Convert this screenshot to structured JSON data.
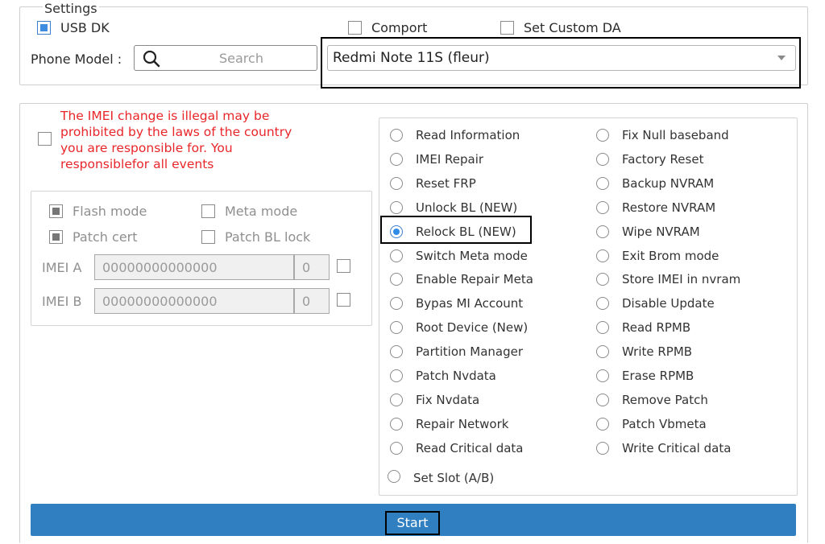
{
  "settings": {
    "title": "Settings",
    "usb_dk": {
      "label": "USB DK",
      "checked": true
    },
    "comport": {
      "label": "Comport",
      "checked": false
    },
    "set_custom_da": {
      "label": "Set Custom DA",
      "checked": false
    },
    "phone_model_label": "Phone Model :",
    "search_placeholder": "Search",
    "model_selected": "Redmi Note 11S (fleur)"
  },
  "imei": {
    "warning": "The IMEI change is illegal may be prohibited by the laws of the country you are responsible for. You responsiblefor all events",
    "flash_mode": "Flash mode",
    "meta_mode": "Meta mode",
    "patch_cert": "Patch cert",
    "patch_bl_lock": "Patch BL lock",
    "imei_a_label": "IMEI A",
    "imei_a_value": "00000000000000",
    "imei_a_check": "0",
    "imei_b_label": "IMEI B",
    "imei_b_value": "00000000000000",
    "imei_b_check": "0"
  },
  "operations": {
    "left": [
      "Read Information",
      "IMEI Repair",
      "Reset FRP",
      "Unlock BL (NEW)",
      "Relock BL (NEW)",
      "Switch Meta mode",
      "Enable Repair Meta",
      "Bypas MI Account",
      "Root Device (New)",
      "Partition Manager",
      "Patch Nvdata",
      "Fix Nvdata",
      "Repair Network",
      "Read Critical data"
    ],
    "right": [
      "Fix Null baseband",
      "Factory Reset",
      "Backup NVRAM",
      "Restore NVRAM",
      "Wipe NVRAM",
      "Exit Brom mode",
      "Store IMEI in nvram",
      "Disable Update",
      "Read RPMB",
      "Write RPMB",
      "Erase RPMB",
      "Remove Patch",
      "Patch Vbmeta",
      "Write Critical data"
    ],
    "extra": "Set Slot (A/B)",
    "selected": "Relock BL (NEW)"
  },
  "start_label": "Start",
  "colors": {
    "accent": "#2f7fc1",
    "warning": "#e8262a",
    "radio_selected": "#2f8be8"
  }
}
